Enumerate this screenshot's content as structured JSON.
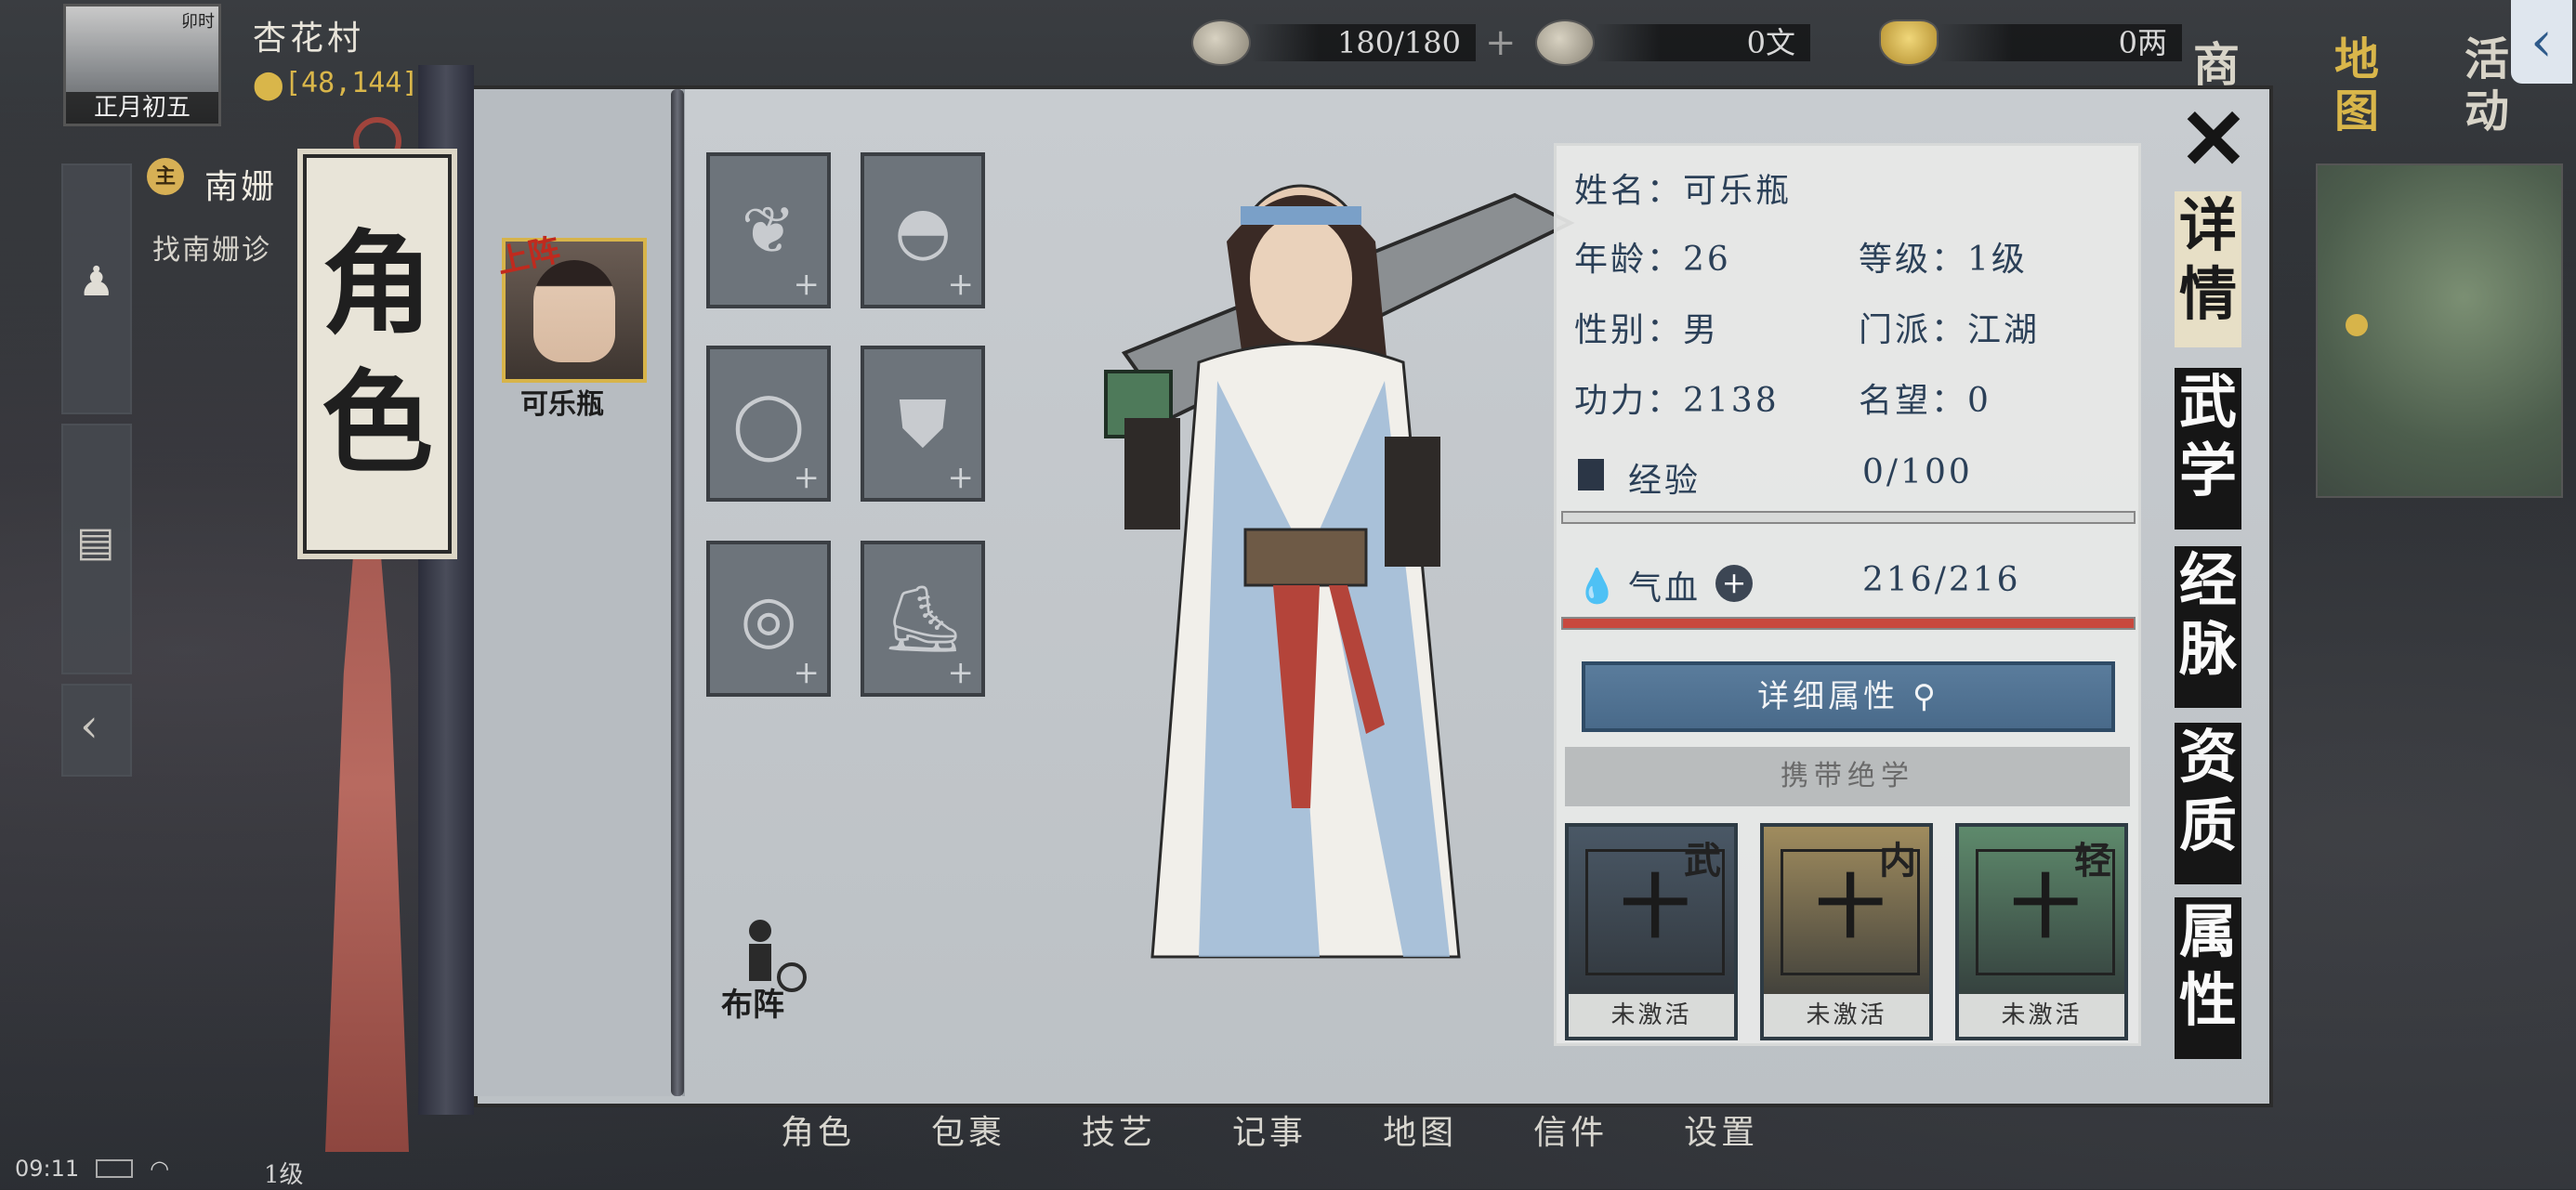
{
  "location": {
    "time_label": "卯时",
    "date_label": "正月初五",
    "village": "杏花村",
    "coords": "[48,144]"
  },
  "resources": [
    {
      "name": "stamina",
      "value": "180/180",
      "icon": "coin-stack-icon"
    },
    {
      "name": "copper",
      "value": "0文",
      "icon": "flower-coin-icon"
    },
    {
      "name": "silver",
      "value": "0两",
      "icon": "ingot-icon"
    }
  ],
  "top_nav": [
    "商",
    "地图",
    "活动"
  ],
  "quest": {
    "tag": "主",
    "title": "南姗",
    "desc": "找南姗诊"
  },
  "banner_title": "角色",
  "character": {
    "deploy_tag": "上阵",
    "name": "可乐瓶"
  },
  "equipment_slots": [
    {
      "slot": "weapon",
      "icon": "shoulder-guard-icon"
    },
    {
      "slot": "hat",
      "icon": "straw-hat-icon"
    },
    {
      "slot": "necklace",
      "icon": "necklace-icon"
    },
    {
      "slot": "armor",
      "icon": "robe-icon"
    },
    {
      "slot": "ring",
      "icon": "ring-icon"
    },
    {
      "slot": "boots",
      "icon": "boots-icon"
    }
  ],
  "formation_label": "布阵",
  "stats": {
    "name_label": "姓名：可乐瓶",
    "age": "年龄：26",
    "level": "等级：1级",
    "gender": "性别：男",
    "sect": "门派：江湖",
    "power": "功力：2138",
    "fame": "名望：0",
    "exp_label": "经验",
    "exp_value": "0/100",
    "exp_fraction": 0.0,
    "hp_label": "气血",
    "hp_value": "216/216",
    "hp_fraction": 1.0
  },
  "detail_button": "详细属性",
  "carry_label": "携带绝学",
  "skills": [
    {
      "kind": "武",
      "state": "未激活",
      "color": "#4a5866"
    },
    {
      "kind": "内",
      "state": "未激活",
      "color": "#a08c5e"
    },
    {
      "kind": "轻",
      "state": "未激活",
      "color": "#5e8a6c"
    }
  ],
  "side_tabs": [
    {
      "label": "详情",
      "active": true
    },
    {
      "label": "武学",
      "active": false
    },
    {
      "label": "经脉",
      "active": false
    },
    {
      "label": "资质",
      "active": false
    },
    {
      "label": "属性",
      "active": false
    }
  ],
  "bottom_nav": [
    "角色",
    "包裹",
    "技艺",
    "记事",
    "地图",
    "信件",
    "设置"
  ],
  "status": {
    "clock": "09:11",
    "level": "1级"
  },
  "colors": {
    "accent_gold": "#d7b44a",
    "hp_bar": "#c8483e",
    "button_blue": "#5a7c9c"
  }
}
